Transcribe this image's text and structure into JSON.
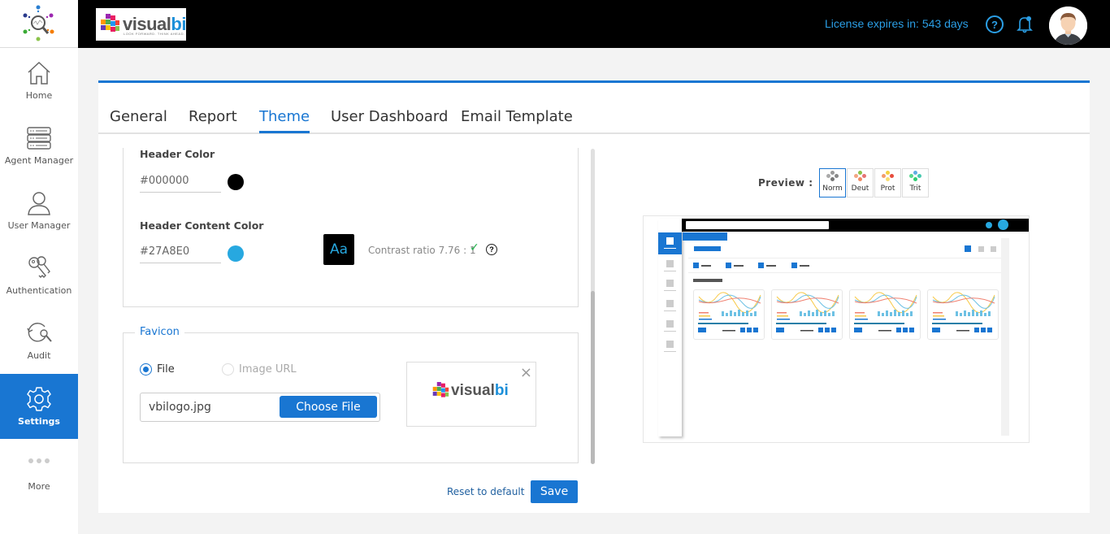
{
  "header": {
    "license_text": "License expires in: 543 days",
    "brand_name_part1": "visual",
    "brand_name_part2": "bi",
    "brand_tagline": "LOOK FORWARD. THINK AHEAD.",
    "help_label": "?",
    "accent_color": "#2b9fe6"
  },
  "sidebar": {
    "items": [
      {
        "label": "Home",
        "icon": "home-icon"
      },
      {
        "label": "Agent Manager",
        "icon": "server-icon"
      },
      {
        "label": "User Manager",
        "icon": "user-icon"
      },
      {
        "label": "Authentication",
        "icon": "keys-icon"
      },
      {
        "label": "Audit",
        "icon": "audit-icon"
      },
      {
        "label": "Settings",
        "icon": "gear-icon",
        "active": true
      },
      {
        "label": "More",
        "icon": "more-icon"
      }
    ]
  },
  "tabs": [
    {
      "label": "General"
    },
    {
      "label": "Report"
    },
    {
      "label": "Theme",
      "active": true
    },
    {
      "label": "User Dashboard"
    },
    {
      "label": "Email Template"
    }
  ],
  "theme": {
    "header_color": {
      "label": "Header Color",
      "value": "#000000",
      "swatch": "#000000"
    },
    "header_content_color": {
      "label": "Header Content Color",
      "value": "#27A8E0",
      "swatch": "#27A8E0"
    },
    "sample_text": "Aa",
    "contrast_text": "Contrast ratio 7.76 : 1",
    "contrast_ok": "✓",
    "contrast_help": "?"
  },
  "favicon": {
    "legend": "Favicon",
    "option_file": "File",
    "option_url": "Image URL",
    "selected": "File",
    "filename": "vbilogo.jpg",
    "choose_button": "Choose File",
    "remove_icon": "×"
  },
  "preview": {
    "label": "Preview :",
    "modes": [
      {
        "label": "Norm",
        "active": true
      },
      {
        "label": "Deut"
      },
      {
        "label": "Prot"
      },
      {
        "label": "Trit"
      }
    ]
  },
  "actions": {
    "reset_label": "Reset to default",
    "save_label": "Save"
  },
  "colors": {
    "primary": "#1976d2",
    "header_bg": "#000000"
  }
}
